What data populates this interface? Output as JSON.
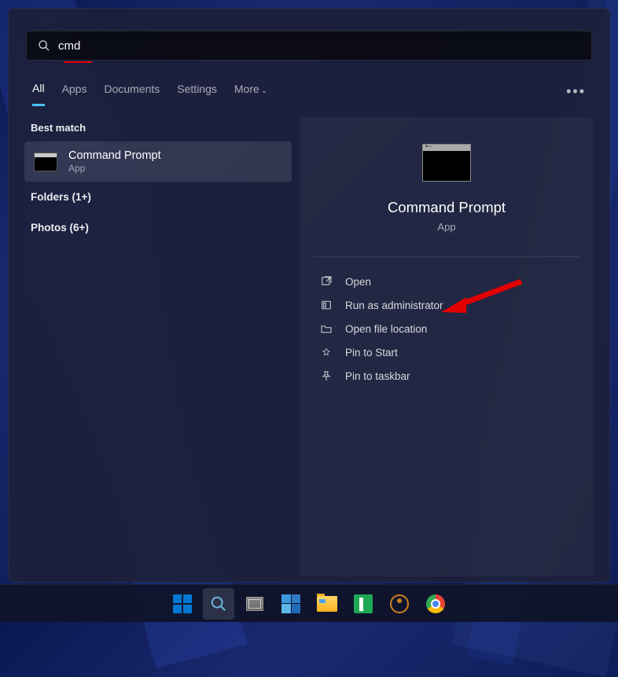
{
  "search": {
    "value": "cmd"
  },
  "tabs": {
    "all": "All",
    "apps": "Apps",
    "documents": "Documents",
    "settings": "Settings",
    "more": "More"
  },
  "left": {
    "best_match_label": "Best match",
    "result_title": "Command Prompt",
    "result_sub": "App",
    "folders": "Folders (1+)",
    "photos": "Photos (6+)"
  },
  "preview": {
    "title": "Command Prompt",
    "sub": "App"
  },
  "actions": {
    "open": "Open",
    "run_admin": "Run as administrator",
    "open_loc": "Open file location",
    "pin_start": "Pin to Start",
    "pin_taskbar": "Pin to taskbar"
  }
}
